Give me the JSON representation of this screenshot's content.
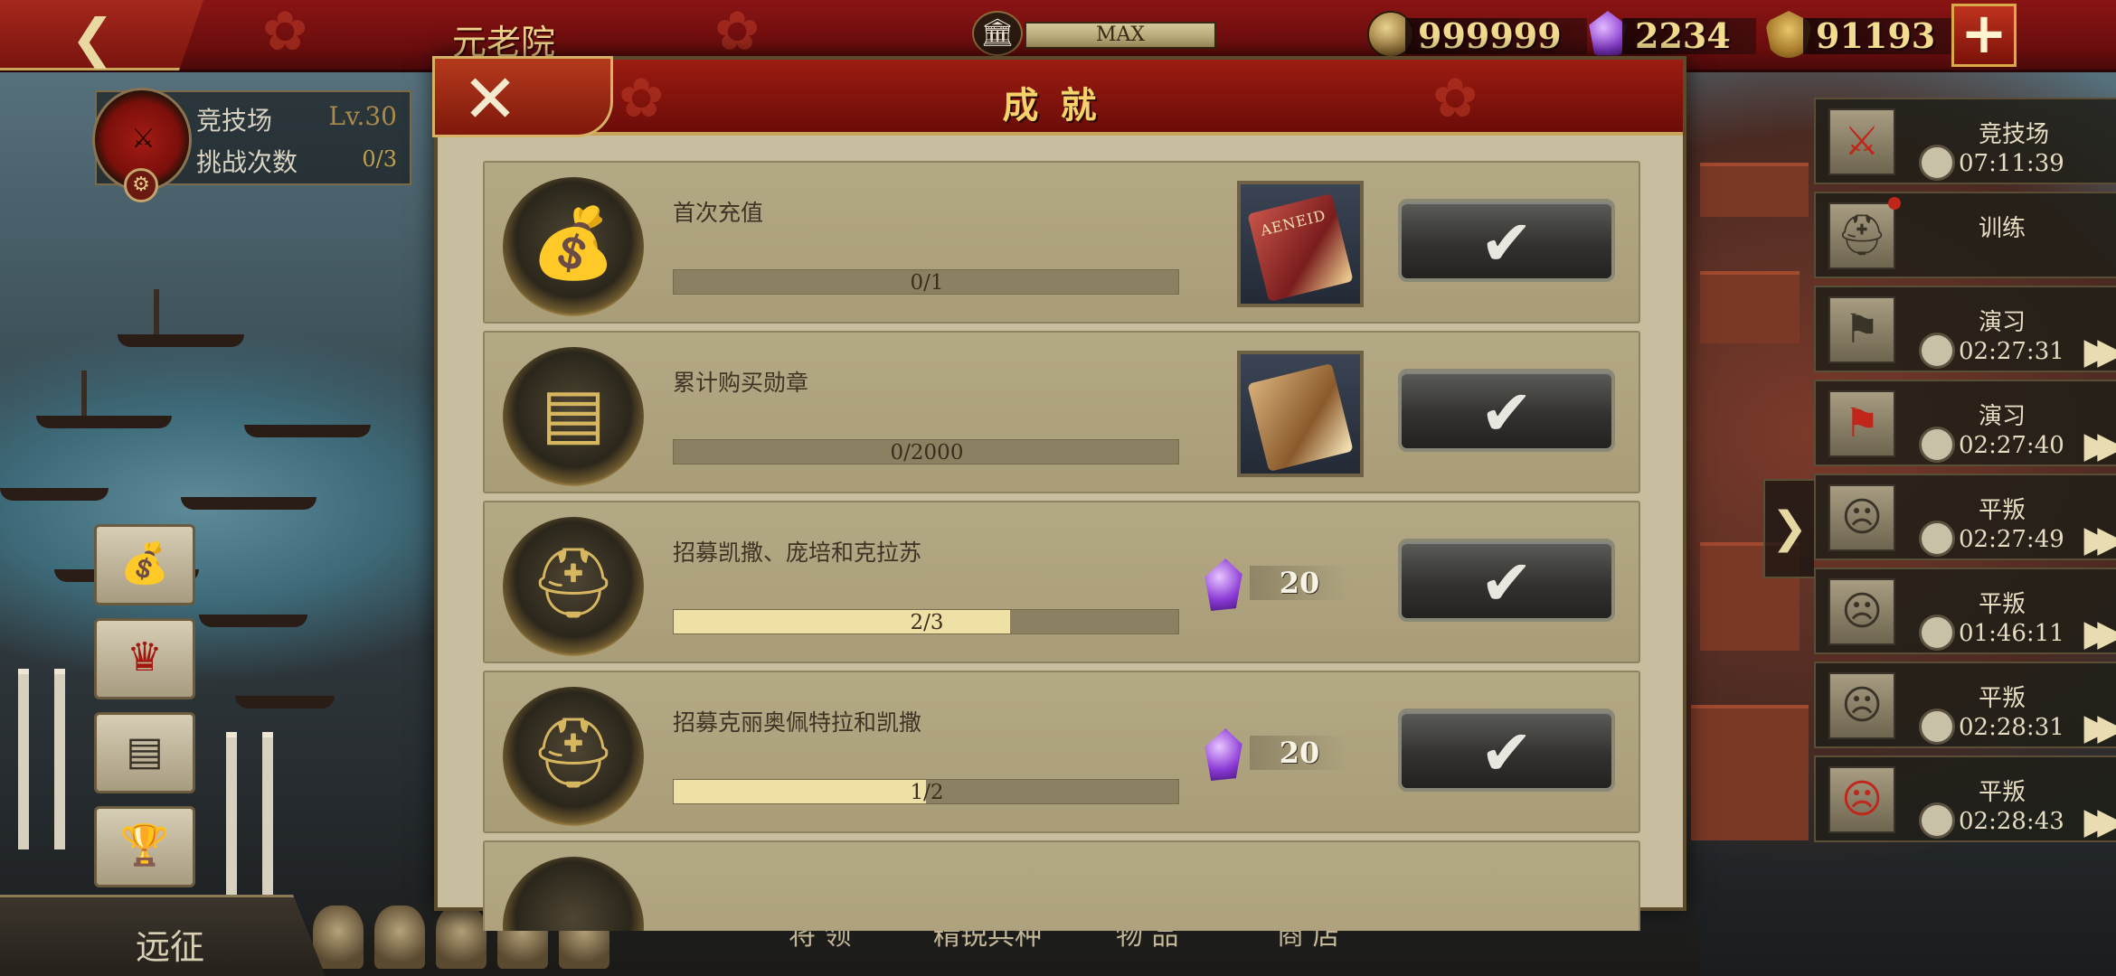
{
  "topbar": {
    "back_icon": "back-arrow-icon",
    "screen_title": "元老院",
    "senate_level": "MAX",
    "gold": "999999",
    "gems": "2234",
    "honor": "91193",
    "add_button_icon": "plus-icon"
  },
  "arena_card": {
    "name": "竞技场",
    "level": "Lv.30",
    "challenge_label": "挑战次数",
    "challenge_count": "0/3"
  },
  "left_buttons": [
    {
      "icon": "money-bag-icon"
    },
    {
      "icon": "crown-icon"
    },
    {
      "icon": "chest-icon"
    },
    {
      "icon": "trophy-icon"
    }
  ],
  "expedition_label": "远征",
  "bottom_tabs": [
    "将 领",
    "精锐兵种",
    "物 品",
    "商 店"
  ],
  "dialog": {
    "title": "成就",
    "close_icon": "close-icon",
    "achievements": [
      {
        "name": "首次充值",
        "progress": "0/1",
        "fraction": 0.0,
        "reward_type": "item",
        "reward_icon": "red-book-icon",
        "reward_text": "AENEID"
      },
      {
        "name": "累计购买勋章",
        "progress": "0/2000",
        "fraction": 0.0,
        "reward_type": "item",
        "reward_icon": "brown-book-icon",
        "reward_text": ""
      },
      {
        "name": "招募凯撒、庞培和克拉苏",
        "progress": "2/3",
        "fraction": 0.667,
        "reward_type": "gem",
        "reward_value": "20"
      },
      {
        "name": "招募克丽奥佩特拉和凯撒",
        "progress": "1/2",
        "fraction": 0.5,
        "reward_type": "gem",
        "reward_value": "20"
      }
    ]
  },
  "events": [
    {
      "name": "竞技场",
      "time": "07:11:39",
      "icon": "crossed-swords-icon",
      "has_ff": false,
      "dot": false
    },
    {
      "name": "训练",
      "time": "",
      "icon": "helmet-icon",
      "has_ff": false,
      "dot": true
    },
    {
      "name": "演习",
      "time": "02:27:31",
      "icon": "banner-icon",
      "has_ff": true,
      "dot": false
    },
    {
      "name": "演习",
      "time": "02:27:40",
      "icon": "banner-icon",
      "has_ff": true,
      "dot": false
    },
    {
      "name": "平叛",
      "time": "02:27:49",
      "icon": "mask-icon",
      "has_ff": true,
      "dot": false
    },
    {
      "name": "平叛",
      "time": "01:46:11",
      "icon": "mask-icon",
      "has_ff": true,
      "dot": false
    },
    {
      "name": "平叛",
      "time": "02:28:31",
      "icon": "mask-icon",
      "has_ff": true,
      "dot": false
    },
    {
      "name": "平叛",
      "time": "02:28:43",
      "icon": "mask-icon",
      "has_ff": true,
      "dot": false
    }
  ],
  "colors": {
    "banner_red": "#8a1414",
    "gold_text": "#f3dc8e",
    "parchment": "#c8bd9e",
    "progress_fill": "#efe0a6"
  }
}
